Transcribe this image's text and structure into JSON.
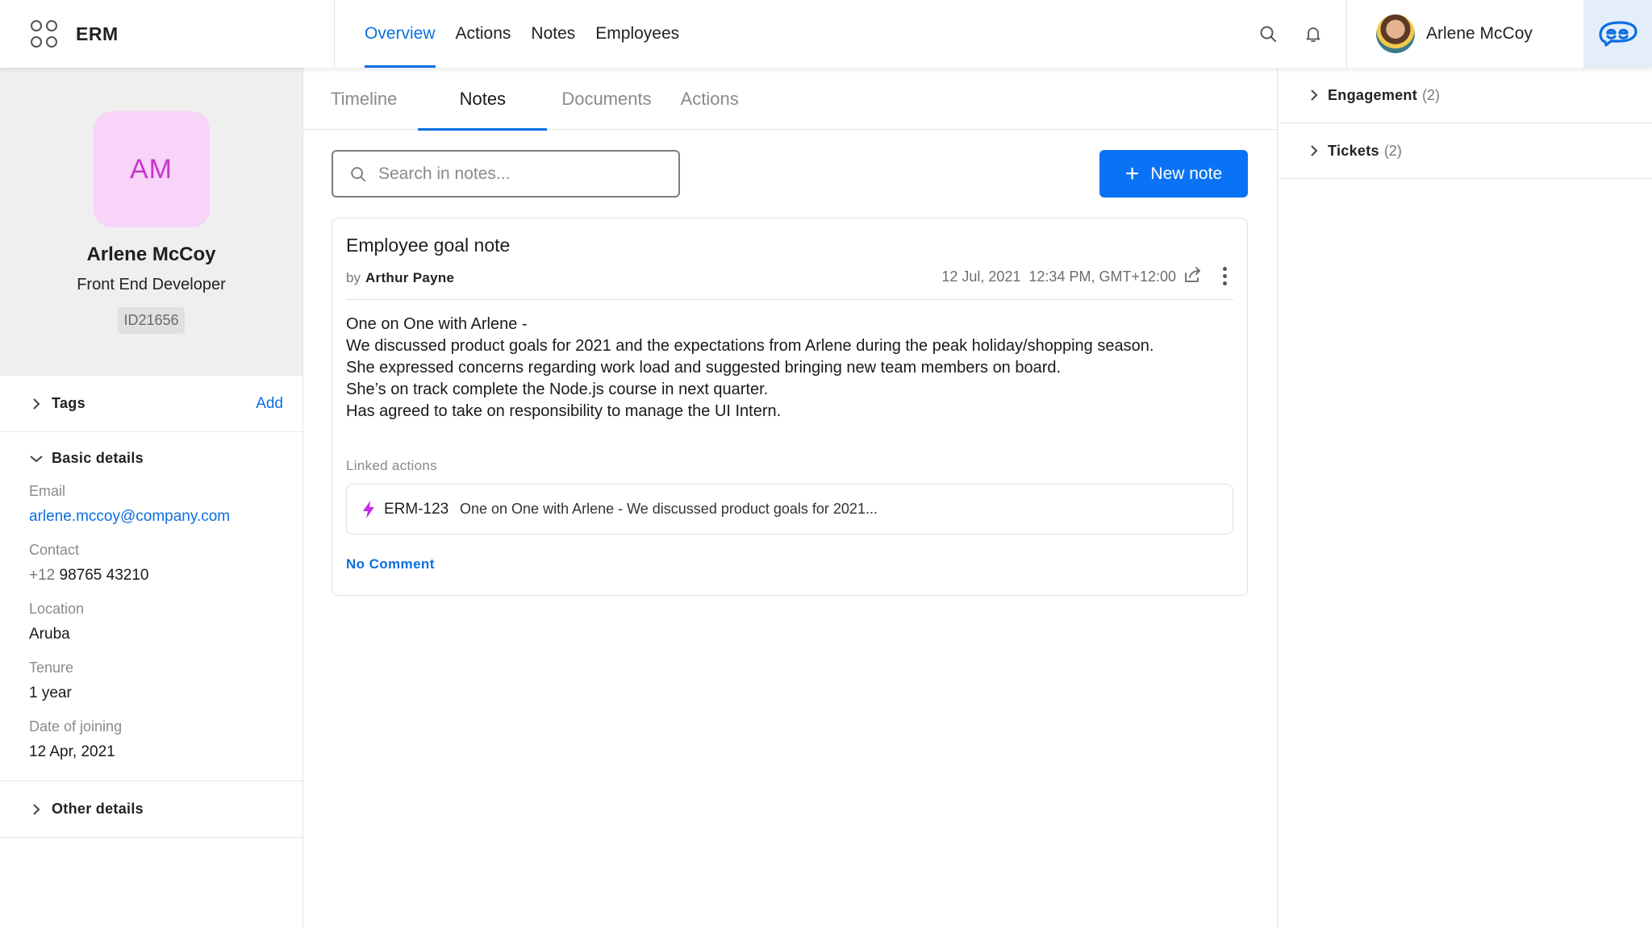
{
  "app": {
    "name": "ERM"
  },
  "nav": {
    "items": [
      {
        "label": "Overview",
        "active": true
      },
      {
        "label": "Actions",
        "active": false
      },
      {
        "label": "Notes",
        "active": false
      },
      {
        "label": "Employees",
        "active": false
      }
    ]
  },
  "user": {
    "name": "Arlene McCoy"
  },
  "profile": {
    "initials": "AM",
    "name": "Arlene McCoy",
    "role": "Front End Developer",
    "employee_id": "ID21656"
  },
  "tags": {
    "label": "Tags",
    "action": "Add"
  },
  "basic_details": {
    "title": "Basic details",
    "fields": {
      "email": {
        "label": "Email",
        "value": "arlene.mccoy@company.com"
      },
      "contact": {
        "label": "Contact",
        "code": "+12",
        "value": "98765 43210"
      },
      "location": {
        "label": "Location",
        "value": "Aruba"
      },
      "tenure": {
        "label": "Tenure",
        "value": "1 year"
      },
      "doj": {
        "label": "Date of joining",
        "value": "12 Apr, 2021"
      }
    }
  },
  "other_details": {
    "label": "Other details"
  },
  "tabs": [
    {
      "label": "Timeline",
      "active": false
    },
    {
      "label": "Notes",
      "active": true
    },
    {
      "label": "Documents",
      "active": false
    },
    {
      "label": "Actions",
      "active": false
    }
  ],
  "search": {
    "placeholder": "Search in notes...",
    "value": ""
  },
  "new_note_button": {
    "label": "New note"
  },
  "note": {
    "title": "Employee goal note",
    "by_prefix": "by",
    "author": "Arthur Payne",
    "date": "12 Jul, 2021",
    "time": "12:34 PM, GMT+12:00",
    "body": [
      "One on One with Arlene -",
      "We discussed product goals for 2021 and the expectations from Arlene during the peak holiday/shopping season.",
      "She expressed concerns regarding work load and suggested bringing new team members on board.",
      "She’s on track complete the Node.js course in next quarter.",
      "Has agreed to take on responsibility to manage the UI Intern."
    ],
    "linked_label": "Linked actions",
    "linked_action": {
      "id": "ERM-123",
      "text": "One on One with Arlene - We discussed product goals for 2021..."
    },
    "comment_link": "No Comment"
  },
  "right_panel": {
    "engagement": {
      "label": "Engagement",
      "count": "(2)"
    },
    "tickets": {
      "label": "Tickets",
      "count": "(2)"
    }
  },
  "colors": {
    "accent": "#0b6fe0",
    "button": "#0a73f5",
    "initials_bg": "#f7d4f8",
    "initials_fg": "#c934d0",
    "bolt": "#c32be8"
  },
  "icons": [
    "apps-grid-icon",
    "search-icon",
    "bell-icon",
    "chevron-right-icon",
    "chevron-down-icon",
    "plus-icon",
    "share-icon",
    "more-vertical-icon",
    "bolt-icon",
    "brand-logo-icon"
  ]
}
